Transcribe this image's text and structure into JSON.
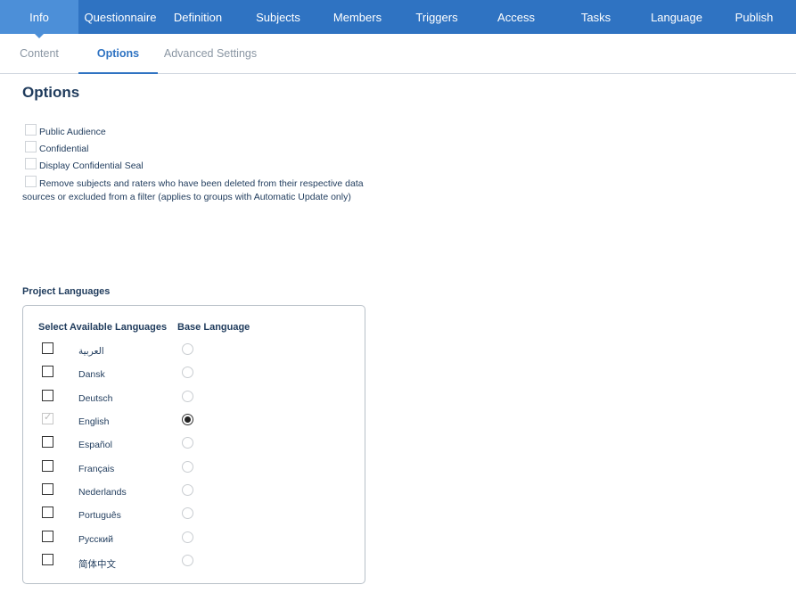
{
  "topnav": {
    "tabs": [
      {
        "label": "Info",
        "active": true
      },
      {
        "label": "Questionnaire",
        "active": false
      },
      {
        "label": "Definition",
        "active": false
      },
      {
        "label": "Subjects",
        "active": false
      },
      {
        "label": "Members",
        "active": false
      },
      {
        "label": "Triggers",
        "active": false
      },
      {
        "label": "Access",
        "active": false
      },
      {
        "label": "Tasks",
        "active": false
      },
      {
        "label": "Language",
        "active": false
      },
      {
        "label": "Publish",
        "active": false
      }
    ]
  },
  "subnav": {
    "tabs": [
      {
        "label": "Content",
        "active": false
      },
      {
        "label": "Options",
        "active": true
      },
      {
        "label": "Advanced Settings",
        "active": false
      }
    ]
  },
  "page": {
    "title": "Options",
    "options": [
      {
        "label": "Public Audience",
        "checked": false
      },
      {
        "label": "Confidential",
        "checked": false
      },
      {
        "label": "Display Confidential Seal",
        "checked": false
      },
      {
        "label": "Remove subjects and raters who have been deleted from their respective data sources or excluded from a filter (applies to groups with Automatic Update only)",
        "checked": false
      }
    ]
  },
  "languages": {
    "section_label": "Project Languages",
    "col_select": "Select Available Languages",
    "col_base": "Base Language",
    "items": [
      {
        "name": "العربية",
        "selected": false,
        "base": false
      },
      {
        "name": "Dansk",
        "selected": false,
        "base": false
      },
      {
        "name": "Deutsch",
        "selected": false,
        "base": false
      },
      {
        "name": "English",
        "selected": true,
        "base": true
      },
      {
        "name": "Español",
        "selected": false,
        "base": false
      },
      {
        "name": "Français",
        "selected": false,
        "base": false
      },
      {
        "name": "Nederlands",
        "selected": false,
        "base": false
      },
      {
        "name": "Português",
        "selected": false,
        "base": false
      },
      {
        "name": "Русский",
        "selected": false,
        "base": false
      },
      {
        "name": "简体中文",
        "selected": false,
        "base": false
      }
    ]
  },
  "colors": {
    "nav_bg": "#2f73c2",
    "nav_active": "#4c8fd8",
    "text": "#1f3b5c",
    "subtab_active": "#2f73c2"
  }
}
